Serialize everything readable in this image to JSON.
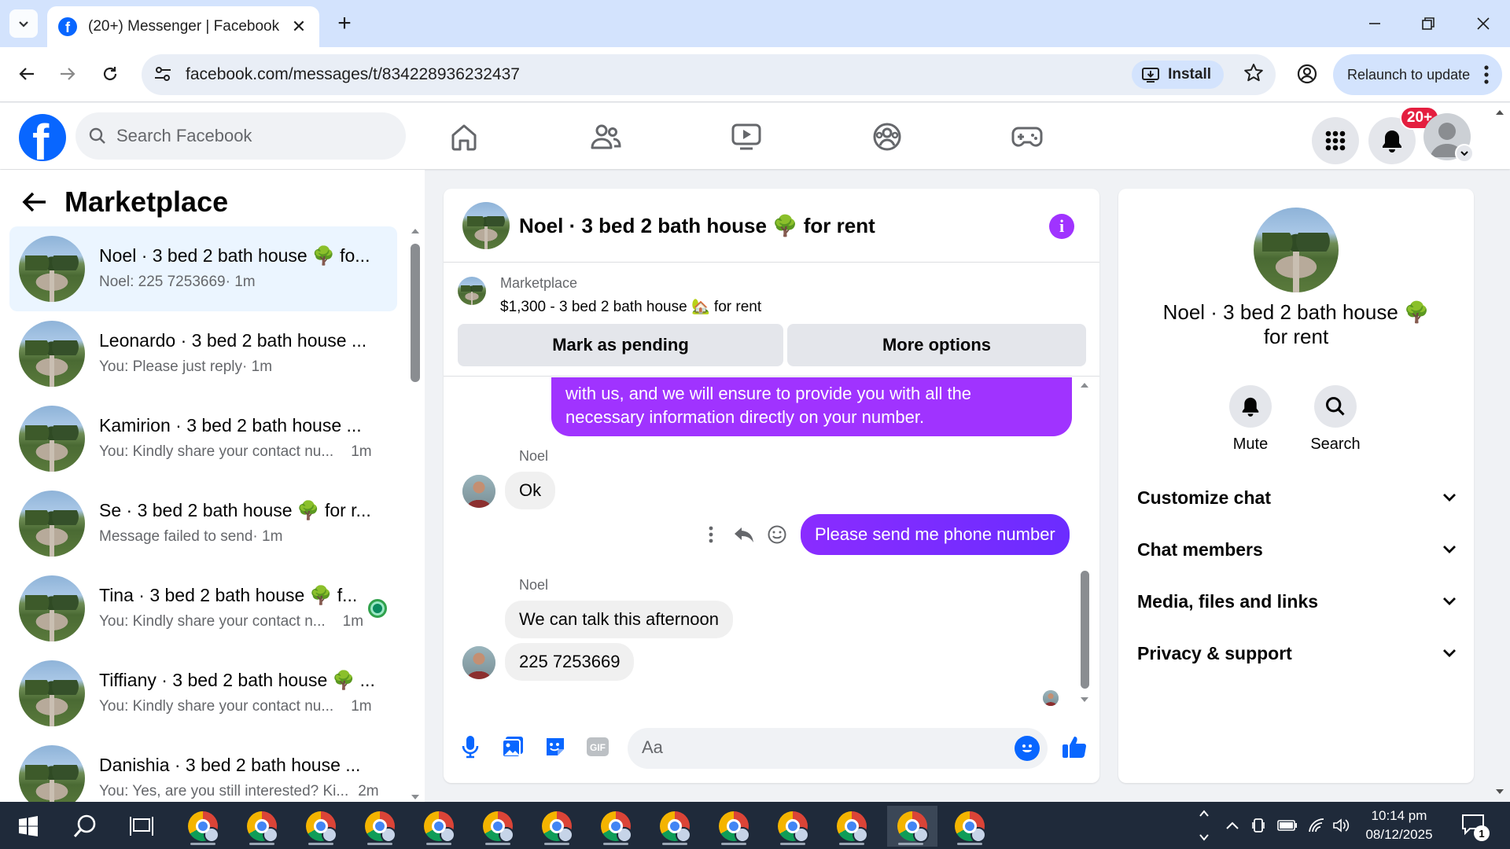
{
  "browser": {
    "tab_title": "(20+) Messenger | Facebook",
    "url": "facebook.com/messages/t/834228936232437",
    "install_label": "Install",
    "relaunch_label": "Relaunch to update"
  },
  "fb": {
    "search_placeholder": "Search Facebook",
    "notifications_badge": "20+"
  },
  "sidebar": {
    "title": "Marketplace",
    "conversations": [
      {
        "name": "Noel · 3 bed 2 bath house 🌳 fo...",
        "preview": "Noel: 225 7253669",
        "time": "· 1m",
        "active": true
      },
      {
        "name": "Leonardo · 3 bed 2 bath house ...",
        "preview": "You: Please just reply",
        "time": "· 1m"
      },
      {
        "name": "Kamirion · 3 bed 2 bath house ...",
        "preview": "You: Kindly share your contact nu...",
        "time": "1m"
      },
      {
        "name": "Se · 3 bed 2 bath house 🌳 for r...",
        "preview": "Message failed to send",
        "time": "· 1m"
      },
      {
        "name": "Tina · 3 bed 2 bath house 🌳 f...",
        "preview": "You: Kindly share your contact n...",
        "time": "1m",
        "online": true
      },
      {
        "name": "Tiffiany · 3 bed 2 bath house 🌳 ...",
        "preview": "You: Kindly share your contact nu...",
        "time": "1m"
      },
      {
        "name": "Danishia · 3 bed 2 bath house ...",
        "preview": "You: Yes, are you still interested? Ki...",
        "time": "2m"
      }
    ]
  },
  "chat": {
    "header_name": "Noel · 3 bed 2 bath house 🌳 for rent",
    "marketplace_label": "Marketplace",
    "listing": "$1,300 - 3 bed 2 bath house 🏡 for rent",
    "mark_pending_label": "Mark as pending",
    "more_options_label": "More options",
    "messages": {
      "out_partial_line1": "with us, and we will ensure to provide you with all the",
      "out_partial_line2": "necessary information directly on your number.",
      "sender1": "Noel",
      "in1": "Ok",
      "out2": "Please send me phone number",
      "sender2": "Noel",
      "in2": "We can talk this afternoon",
      "in3": "225 7253669"
    },
    "composer_placeholder": "Aa"
  },
  "info_panel": {
    "name_line1": "Noel · 3 bed 2 bath house 🌳",
    "name_line2": "for rent",
    "mute_label": "Mute",
    "search_label": "Search",
    "sections": [
      "Customize chat",
      "Chat members",
      "Media, files and links",
      "Privacy & support"
    ]
  },
  "taskbar": {
    "time": "10:14 pm",
    "date": "08/12/2025",
    "notification_count": "1"
  },
  "colors": {
    "fb_blue": "#0866ff",
    "messenger_purple": "#a033ff",
    "active_row": "#ebf5ff",
    "badge_red": "#e41e3f"
  }
}
